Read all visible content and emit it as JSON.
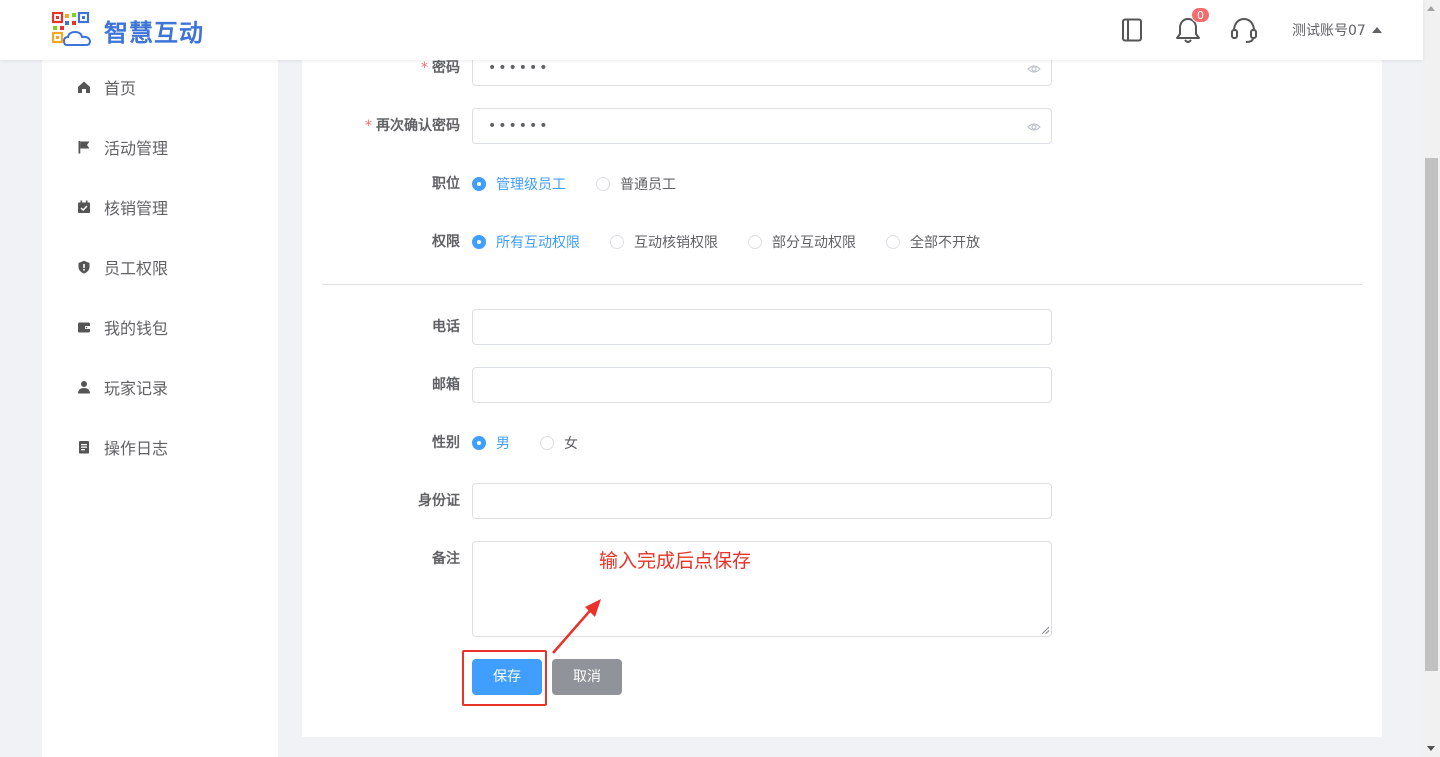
{
  "app": {
    "title": "智慧互动"
  },
  "header": {
    "notification_count": "0",
    "account_name": "测试账号07",
    "icons": [
      "book-icon",
      "bell-icon",
      "headset-icon"
    ]
  },
  "sidebar": {
    "items": [
      {
        "label": "首页",
        "icon": "home-icon"
      },
      {
        "label": "活动管理",
        "icon": "flag-icon"
      },
      {
        "label": "核销管理",
        "icon": "calendar-check-icon"
      },
      {
        "label": "员工权限",
        "icon": "shield-icon"
      },
      {
        "label": "我的钱包",
        "icon": "wallet-icon"
      },
      {
        "label": "玩家记录",
        "icon": "user-icon"
      },
      {
        "label": "操作日志",
        "icon": "document-icon"
      }
    ]
  },
  "form": {
    "password": {
      "label": "密码",
      "value": "••••••",
      "required": true
    },
    "confirm_password": {
      "label": "再次确认密码",
      "value": "••••••",
      "required": true
    },
    "position": {
      "label": "职位",
      "options": [
        "管理级员工",
        "普通员工"
      ],
      "selected": 0
    },
    "permission": {
      "label": "权限",
      "options": [
        "所有互动权限",
        "互动核销权限",
        "部分互动权限",
        "全部不开放"
      ],
      "selected": 0
    },
    "phone": {
      "label": "电话",
      "value": ""
    },
    "email": {
      "label": "邮箱",
      "value": ""
    },
    "gender": {
      "label": "性别",
      "options": [
        "男",
        "女"
      ],
      "selected": 0
    },
    "id_card": {
      "label": "身份证",
      "value": ""
    },
    "remarks": {
      "label": "备注",
      "value": ""
    },
    "save_label": "保存",
    "cancel_label": "取消"
  },
  "annotation": {
    "text": "输入完成后点保存",
    "color": "#e8322a"
  },
  "colors": {
    "primary": "#409eff",
    "brand": "#3e74d8",
    "danger": "#f56c6c",
    "gray_button": "#909399"
  }
}
